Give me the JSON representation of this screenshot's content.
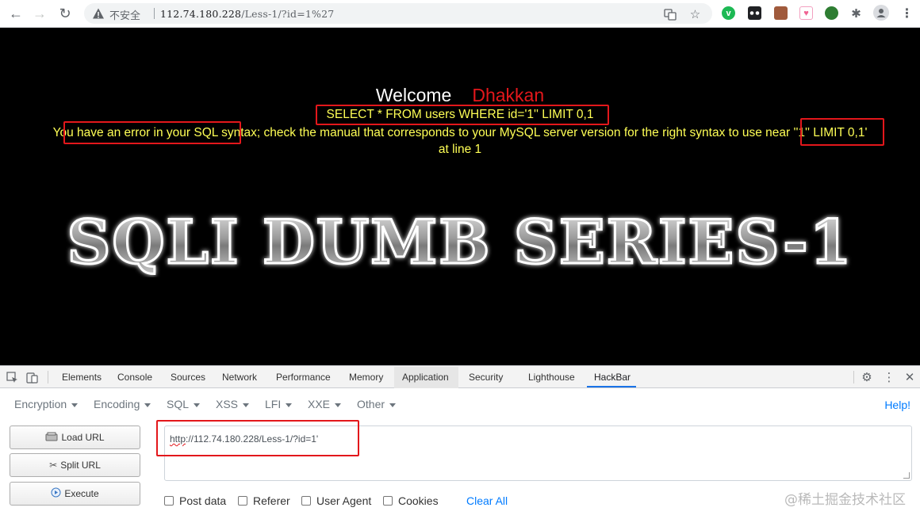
{
  "browser": {
    "security_label": "不安全",
    "url_host": "112.74.180.228",
    "url_path": "/Less-1/?id=1%27"
  },
  "page": {
    "welcome": "Welcome",
    "name": "Dhakkan",
    "query": "SELECT * FROM users WHERE id='1'' LIMIT 0,1",
    "error_prefix": "You have ",
    "error_highlight_1": "an error in your SQL syntax;",
    "error_middle": " check the manual that corresponds to your MySQL server version for the right syntax to use ",
    "error_highlight_2": "near ''1'' LIMIT 0,1'",
    "error_line2": "at line 1",
    "logo_text": "SQLI DUMB SERIES-1"
  },
  "devtools": {
    "tabs": [
      "Elements",
      "Console",
      "Sources",
      "Network",
      "Performance",
      "Memory",
      "Application",
      "Security",
      "Lighthouse",
      "HackBar"
    ],
    "active_tab": "HackBar",
    "highlighted_tab": "Application"
  },
  "hackbar": {
    "menu": [
      "Encryption",
      "Encoding",
      "SQL",
      "XSS",
      "LFI",
      "XXE",
      "Other"
    ],
    "help_label": "Help!",
    "load_url": "Load URL",
    "split_url": "Split URL",
    "execute": "Execute",
    "url_scheme": "http",
    "url_rest": "://112.74.180.228/Less-1/?id=1'",
    "post_data": "Post data",
    "referer": "Referer",
    "user_agent": "User Agent",
    "cookies": "Cookies",
    "clear_all": "Clear All"
  },
  "watermark": "@稀土掘金技术社区",
  "colors": {
    "error_text": "#ffff55",
    "highlight_box": "#e3171b",
    "name": "#e3171b",
    "link": "#007bff"
  }
}
